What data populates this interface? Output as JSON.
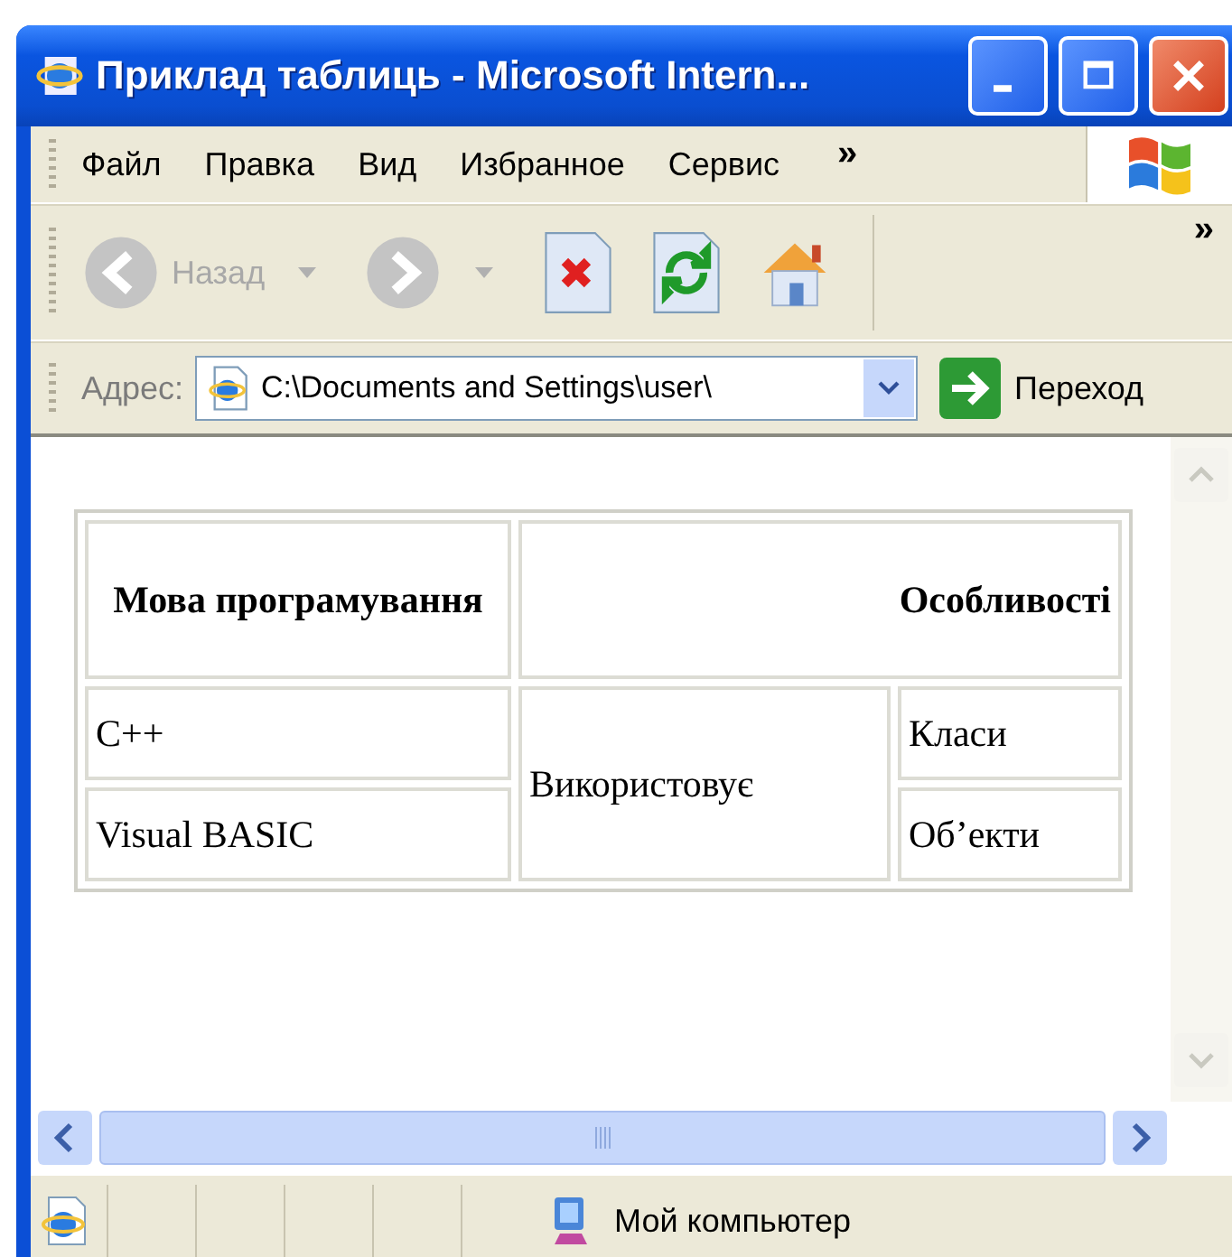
{
  "window": {
    "title": "Приклад таблиць - Microsoft Intern..."
  },
  "menu": {
    "items": [
      "Файл",
      "Правка",
      "Вид",
      "Избранное",
      "Сервис"
    ],
    "more": "»"
  },
  "toolbar": {
    "back_label": "Назад",
    "back_disabled": true,
    "forward_disabled": true,
    "more": "»"
  },
  "address": {
    "label": "Адрес:",
    "value": "C:\\Documents and Settings\\user\\",
    "go": "Переход"
  },
  "table": {
    "columns": [
      "Мова програмування",
      "Особливості"
    ],
    "shared_cell": "Використовує",
    "rows": [
      {
        "language": "C++",
        "feature": "Класи"
      },
      {
        "language": "Visual BASIC",
        "feature": "Об’екти"
      }
    ]
  },
  "status_bar": {
    "zone": "Мой компьютер"
  }
}
